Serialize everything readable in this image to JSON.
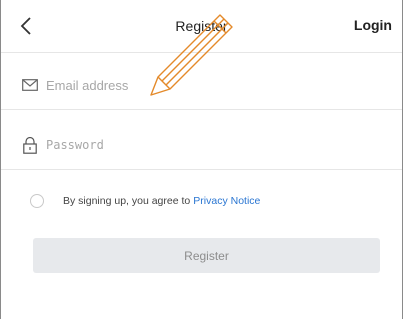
{
  "header": {
    "title": "Register",
    "login_label": "Login",
    "back_icon": "chevron-left-icon"
  },
  "form": {
    "email": {
      "placeholder": "Email address",
      "value": "",
      "icon": "envelope-icon"
    },
    "password": {
      "placeholder": "Password",
      "value": "",
      "icon": "lock-icon"
    },
    "agreement": {
      "text": "By signing up, you agree to",
      "link_label": "Privacy Notice",
      "checked": false
    },
    "register_label": "Register"
  },
  "overlay": {
    "icon": "pencil-icon"
  },
  "colors": {
    "link": "#2a76d2",
    "button_bg": "#e7e9ec",
    "button_text": "#8d8d8d",
    "pencil": "#e48a2a"
  }
}
